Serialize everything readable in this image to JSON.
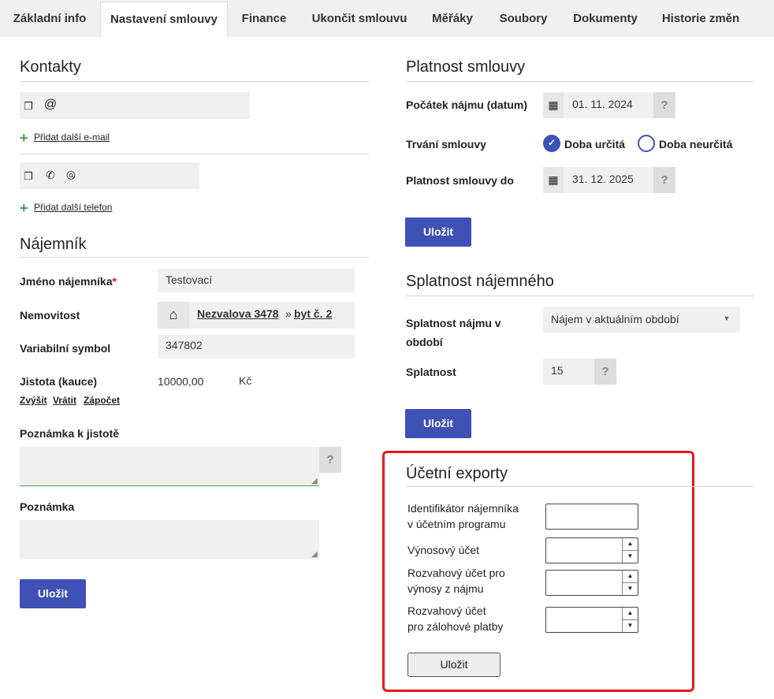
{
  "tabs": [
    "Základní info",
    "Nastavení smlouvy",
    "Finance",
    "Ukončit smlouvu",
    "Měřáky",
    "Soubory",
    "Dokumenty",
    "Historie změn"
  ],
  "kontakty": {
    "title": "Kontakty",
    "add_email": "Přidat další e-mail",
    "add_phone": "Přidat další telefon"
  },
  "najemnik": {
    "title": "Nájemník",
    "name_label": "Jméno nájemníka",
    "required_mark": "*",
    "name_value": "Testovací",
    "property_label": "Nemovitost",
    "property_link": "Nezvalova 3478",
    "separator": "»",
    "unit_link": "byt č. 2",
    "vs_label": "Variabilní symbol",
    "vs_value": "347802",
    "deposit_label": "Jistota (kauce)",
    "deposit_value": "10000,00",
    "deposit_currency": "Kč",
    "deposit_actions": [
      "Zvýšit",
      "Vrátit",
      "Zápočet"
    ],
    "deposit_note_label": "Poznámka k jistotě",
    "note_label": "Poznámka",
    "save": "Uložit"
  },
  "platnost": {
    "title": "Platnost smlouvy",
    "start_label": "Počátek nájmu (datum)",
    "start_value": "01. 11. 2024",
    "duration_label": "Trvání smlouvy",
    "opt_fixed": "Doba určitá",
    "opt_indef": "Doba neurčitá",
    "selected": "Doba určitá",
    "end_label": "Platnost smlouvy do",
    "end_value": "31. 12. 2025",
    "help": "?",
    "save": "Uložit"
  },
  "splatnost": {
    "title": "Splatnost nájemného",
    "period_label_1": "Splatnost nájmu v",
    "period_label_2": "období",
    "period_value": "Nájem v aktuálním období",
    "due_label": "Splatnost",
    "due_value": "15",
    "help": "?",
    "save": "Uložit"
  },
  "exporty": {
    "title": "Účetní exporty",
    "id_label_1": "Identifikátor nájemníka",
    "id_label_2": "v účetním programu",
    "revenue_label": "Výnosový účet",
    "bal1_label_1": "Rozvahový účet pro",
    "bal1_label_2": "výnosy z nájmu",
    "bal2_label_1": "Rozvahový účet",
    "bal2_label_2": "pro zálohové platby",
    "save": "Uložit"
  },
  "colors": {
    "primary": "#3f51b5",
    "highlight": "#e31b1b",
    "add_icon": "#43a047"
  }
}
